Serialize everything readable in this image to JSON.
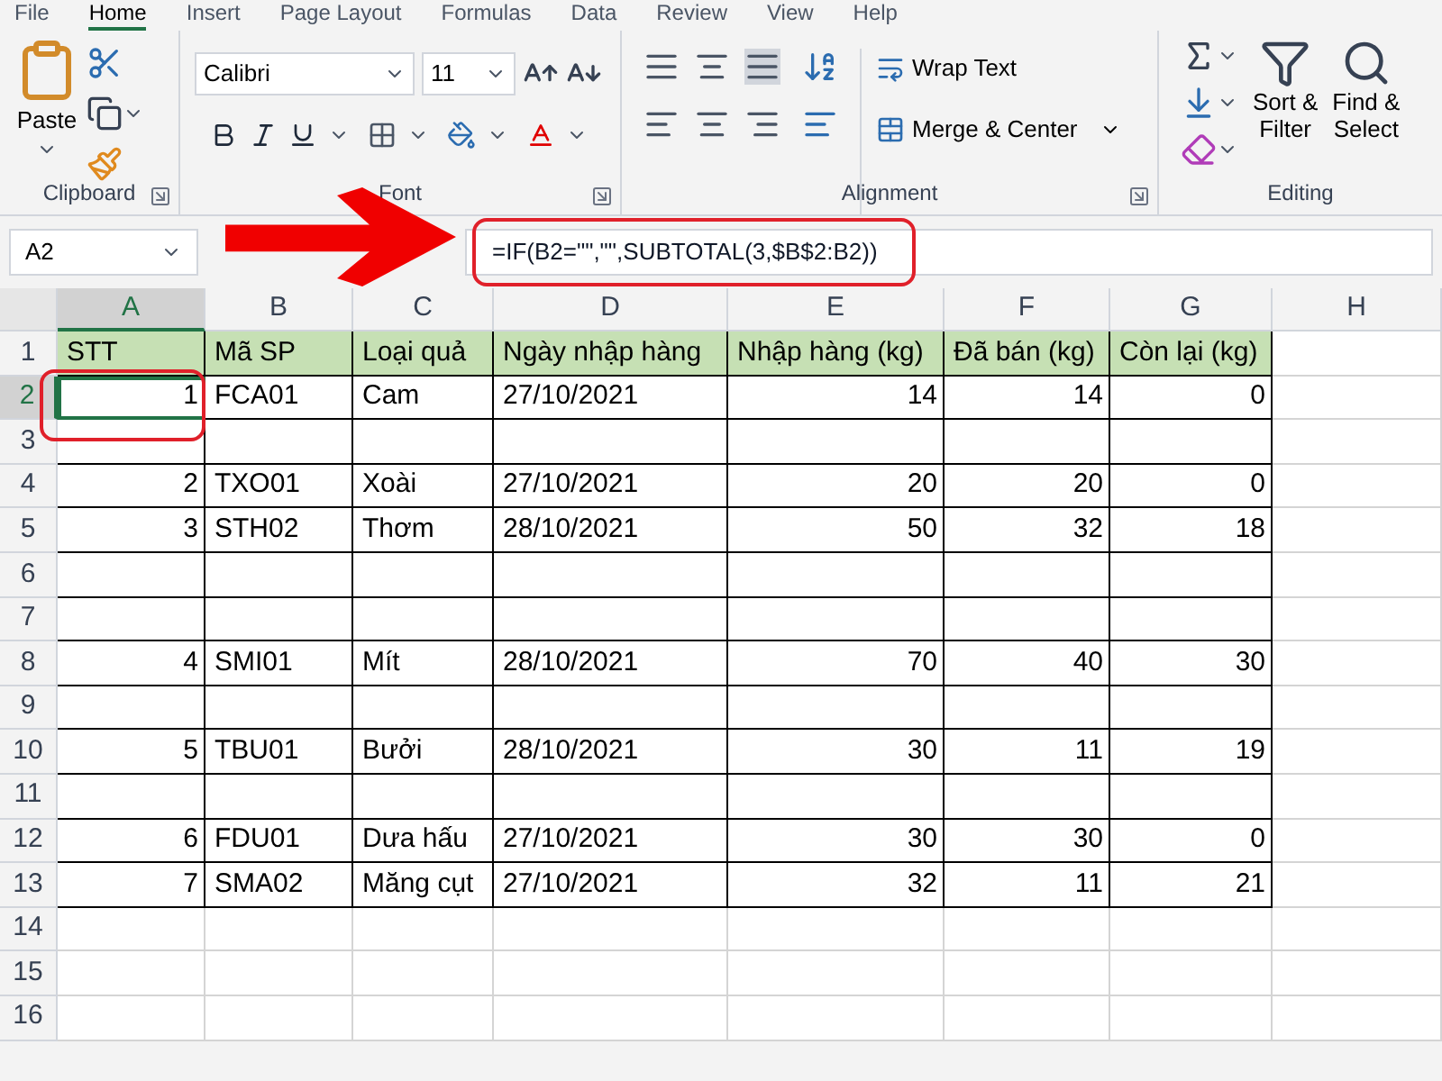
{
  "ribbon_tabs": [
    {
      "label": "File",
      "selected": false
    },
    {
      "label": "Home",
      "selected": true
    },
    {
      "label": "Insert",
      "selected": false
    },
    {
      "label": "Page Layout",
      "selected": false
    },
    {
      "label": "Formulas",
      "selected": false
    },
    {
      "label": "Data",
      "selected": false
    },
    {
      "label": "Review",
      "selected": false
    },
    {
      "label": "View",
      "selected": false
    },
    {
      "label": "Help",
      "selected": false
    }
  ],
  "clipboard": {
    "paste_label": "Paste",
    "group_label": "Clipboard"
  },
  "font": {
    "font_name": "Calibri",
    "font_size": "11",
    "group_label": "Font"
  },
  "alignment": {
    "wrap_text": "Wrap Text",
    "merge_center": "Merge & Center",
    "group_label": "Alignment"
  },
  "editing": {
    "sort_filter": [
      "Sort &",
      "Filter"
    ],
    "find_select": [
      "Find &",
      "Select"
    ],
    "group_label": "Editing"
  },
  "name_box": "A2",
  "formula": "=IF(B2=\"\",\"\",SUBTOTAL(3,$B$2:B2))",
  "columns": [
    {
      "label": "A",
      "selected": true
    },
    {
      "label": "B",
      "selected": false
    },
    {
      "label": "C",
      "selected": false
    },
    {
      "label": "D",
      "selected": false
    },
    {
      "label": "E",
      "selected": false
    },
    {
      "label": "F",
      "selected": false
    },
    {
      "label": "G",
      "selected": false
    },
    {
      "label": "H",
      "selected": false
    }
  ],
  "rows": [
    {
      "number": "1",
      "kind": "header",
      "selected": false,
      "cells": [
        "STT",
        "Mã SP",
        "Loại quả",
        "Ngày nhập hàng",
        "Nhập hàng (kg)",
        "Đã bán (kg)",
        "Còn lại (kg)"
      ]
    },
    {
      "number": "2",
      "kind": "data",
      "selected": true,
      "cells": [
        "1",
        "FCA01",
        "Cam",
        "27/10/2021",
        "14",
        "14",
        "0"
      ]
    },
    {
      "number": "3",
      "kind": "data",
      "selected": false,
      "cells": []
    },
    {
      "number": "4",
      "kind": "data",
      "selected": false,
      "cells": [
        "2",
        "TXO01",
        "Xoài",
        "27/10/2021",
        "20",
        "20",
        "0"
      ]
    },
    {
      "number": "5",
      "kind": "data",
      "selected": false,
      "cells": [
        "3",
        "STH02",
        "Thơm",
        "28/10/2021",
        "50",
        "32",
        "18"
      ]
    },
    {
      "number": "6",
      "kind": "data",
      "selected": false,
      "cells": []
    },
    {
      "number": "7",
      "kind": "data",
      "selected": false,
      "cells": []
    },
    {
      "number": "8",
      "kind": "data",
      "selected": false,
      "cells": [
        "4",
        "SMI01",
        "Mít",
        "28/10/2021",
        "70",
        "40",
        "30"
      ]
    },
    {
      "number": "9",
      "kind": "data",
      "selected": false,
      "cells": []
    },
    {
      "number": "10",
      "kind": "data",
      "selected": false,
      "cells": [
        "5",
        "TBU01",
        "Bưởi",
        "28/10/2021",
        "30",
        "11",
        "19"
      ]
    },
    {
      "number": "11",
      "kind": "data",
      "selected": false,
      "cells": []
    },
    {
      "number": "12",
      "kind": "data",
      "selected": false,
      "cells": [
        "6",
        "FDU01",
        "Dưa hấu",
        "27/10/2021",
        "30",
        "30",
        "0"
      ]
    },
    {
      "number": "13",
      "kind": "data",
      "selected": false,
      "cells": [
        "7",
        "SMA02",
        "Măng cụt",
        "27/10/2021",
        "32",
        "11",
        "21"
      ]
    },
    {
      "number": "14",
      "kind": "blank",
      "selected": false,
      "cells": []
    },
    {
      "number": "15",
      "kind": "blank",
      "selected": false,
      "cells": []
    },
    {
      "number": "16",
      "kind": "blank",
      "selected": false,
      "cells": []
    }
  ]
}
